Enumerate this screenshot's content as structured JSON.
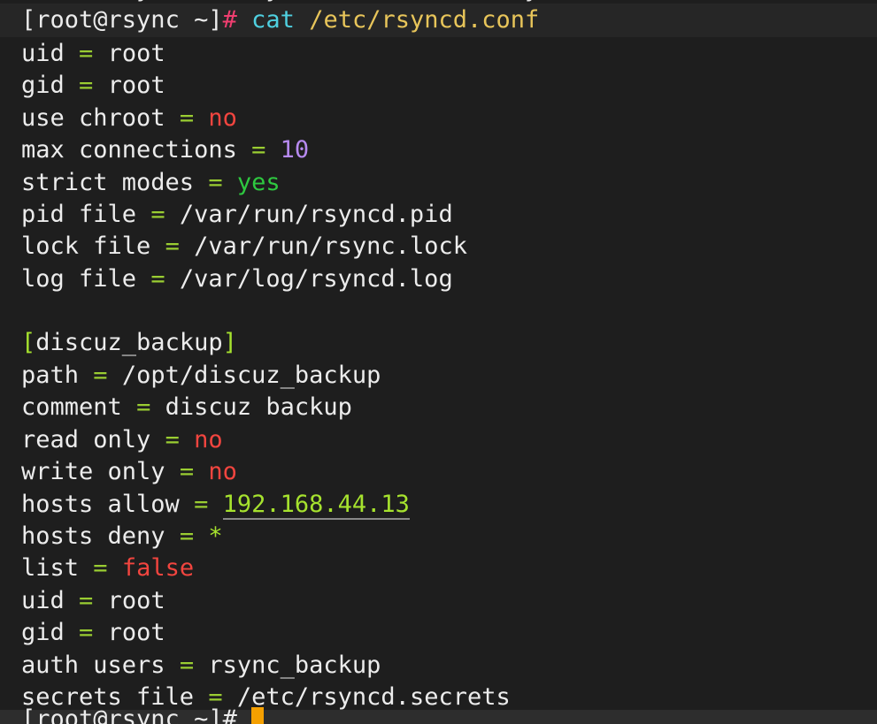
{
  "terminal": {
    "prompt": {
      "bracket_open": "[",
      "user_host": "root@rsync",
      "path": " ~",
      "bracket_close": "]",
      "hash": "#",
      "command_name": "cat",
      "command_arg": "/etc/rsyncd.conf"
    },
    "config_global": [
      {
        "key": "uid",
        "value": "root",
        "color": "plain"
      },
      {
        "key": "gid",
        "value": "root",
        "color": "plain"
      },
      {
        "key": "use chroot",
        "value": "no",
        "color": "red"
      },
      {
        "key": "max connections",
        "value": "10",
        "color": "purple"
      },
      {
        "key": "strict modes",
        "value": "yes",
        "color": "green"
      },
      {
        "key": "pid file",
        "value": "/var/run/rsyncd.pid",
        "color": "plain"
      },
      {
        "key": "lock file",
        "value": "/var/run/rsync.lock",
        "color": "plain"
      },
      {
        "key": "log file",
        "value": "/var/log/rsyncd.log",
        "color": "plain"
      }
    ],
    "section_header": "discuz_backup",
    "config_section": [
      {
        "key": "path",
        "value": "/opt/discuz_backup",
        "color": "plain"
      },
      {
        "key": "comment",
        "value": "discuz backup",
        "color": "plain"
      },
      {
        "key": "read only",
        "value": "no",
        "color": "red"
      },
      {
        "key": "write only",
        "value": "no",
        "color": "red"
      },
      {
        "key": "hosts allow",
        "value": "192.168.44.13",
        "color": "ip"
      },
      {
        "key": "hosts deny",
        "value": "*",
        "color": "lime"
      },
      {
        "key": "list",
        "value": "false",
        "color": "red"
      },
      {
        "key": "uid",
        "value": "root",
        "color": "plain"
      },
      {
        "key": "gid",
        "value": "root",
        "color": "plain"
      },
      {
        "key": "auth users",
        "value": "rsync_backup",
        "color": "plain"
      },
      {
        "key": "secrets file",
        "value": "/etc/rsyncd.secrets",
        "color": "plain"
      }
    ],
    "equals": "=",
    "bottom_prompt": "[root@rsync ~]#"
  },
  "colors": {
    "background": "#1e1e1e",
    "text": "#ececec",
    "equals": "#9acd32",
    "no_false": "#f2453f",
    "yes": "#2ec840",
    "number": "#b78af0",
    "command": "#4fd0e0",
    "argument": "#e8c55a",
    "hash": "#f03e70",
    "ip_section": "#a6e22e",
    "cursor": "#f5a000"
  }
}
